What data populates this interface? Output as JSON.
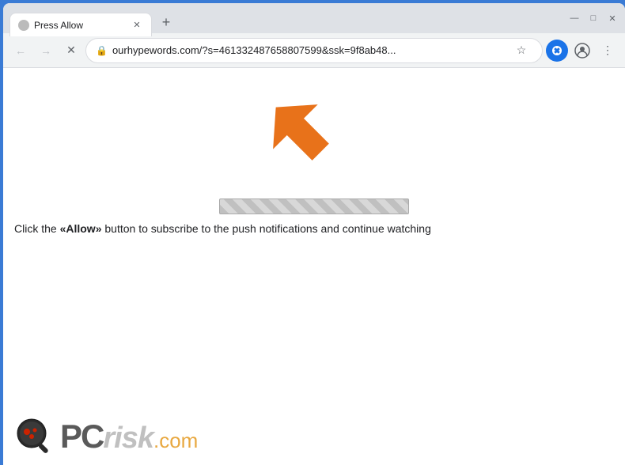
{
  "browser": {
    "tab": {
      "title": "Press Allow",
      "favicon_alt": "tab favicon"
    },
    "new_tab_icon": "+",
    "window_controls": {
      "minimize": "—",
      "maximize": "□",
      "close": "✕"
    },
    "nav": {
      "back": "←",
      "forward": "→",
      "close": "✕"
    },
    "address_bar": {
      "url": "ourhypewords.com/?s=461332487658807599&ssk=9f8ab48...",
      "lock_icon": "🔒"
    },
    "toolbar_icons": {
      "star": "☆",
      "profile": "👤",
      "menu": "⋮",
      "extension": "⬡"
    }
  },
  "page": {
    "message": "Click the «Allow» button to subscribe to the push notifications and continue watching",
    "message_prefix": "Click the ",
    "message_highlight": "«Allow»",
    "message_suffix": " button to subscribe to the push notifications and continue watching",
    "pcrisk_text": "PC",
    "pcrisk_italic": "risk",
    "pcrisk_domain": ".com"
  }
}
